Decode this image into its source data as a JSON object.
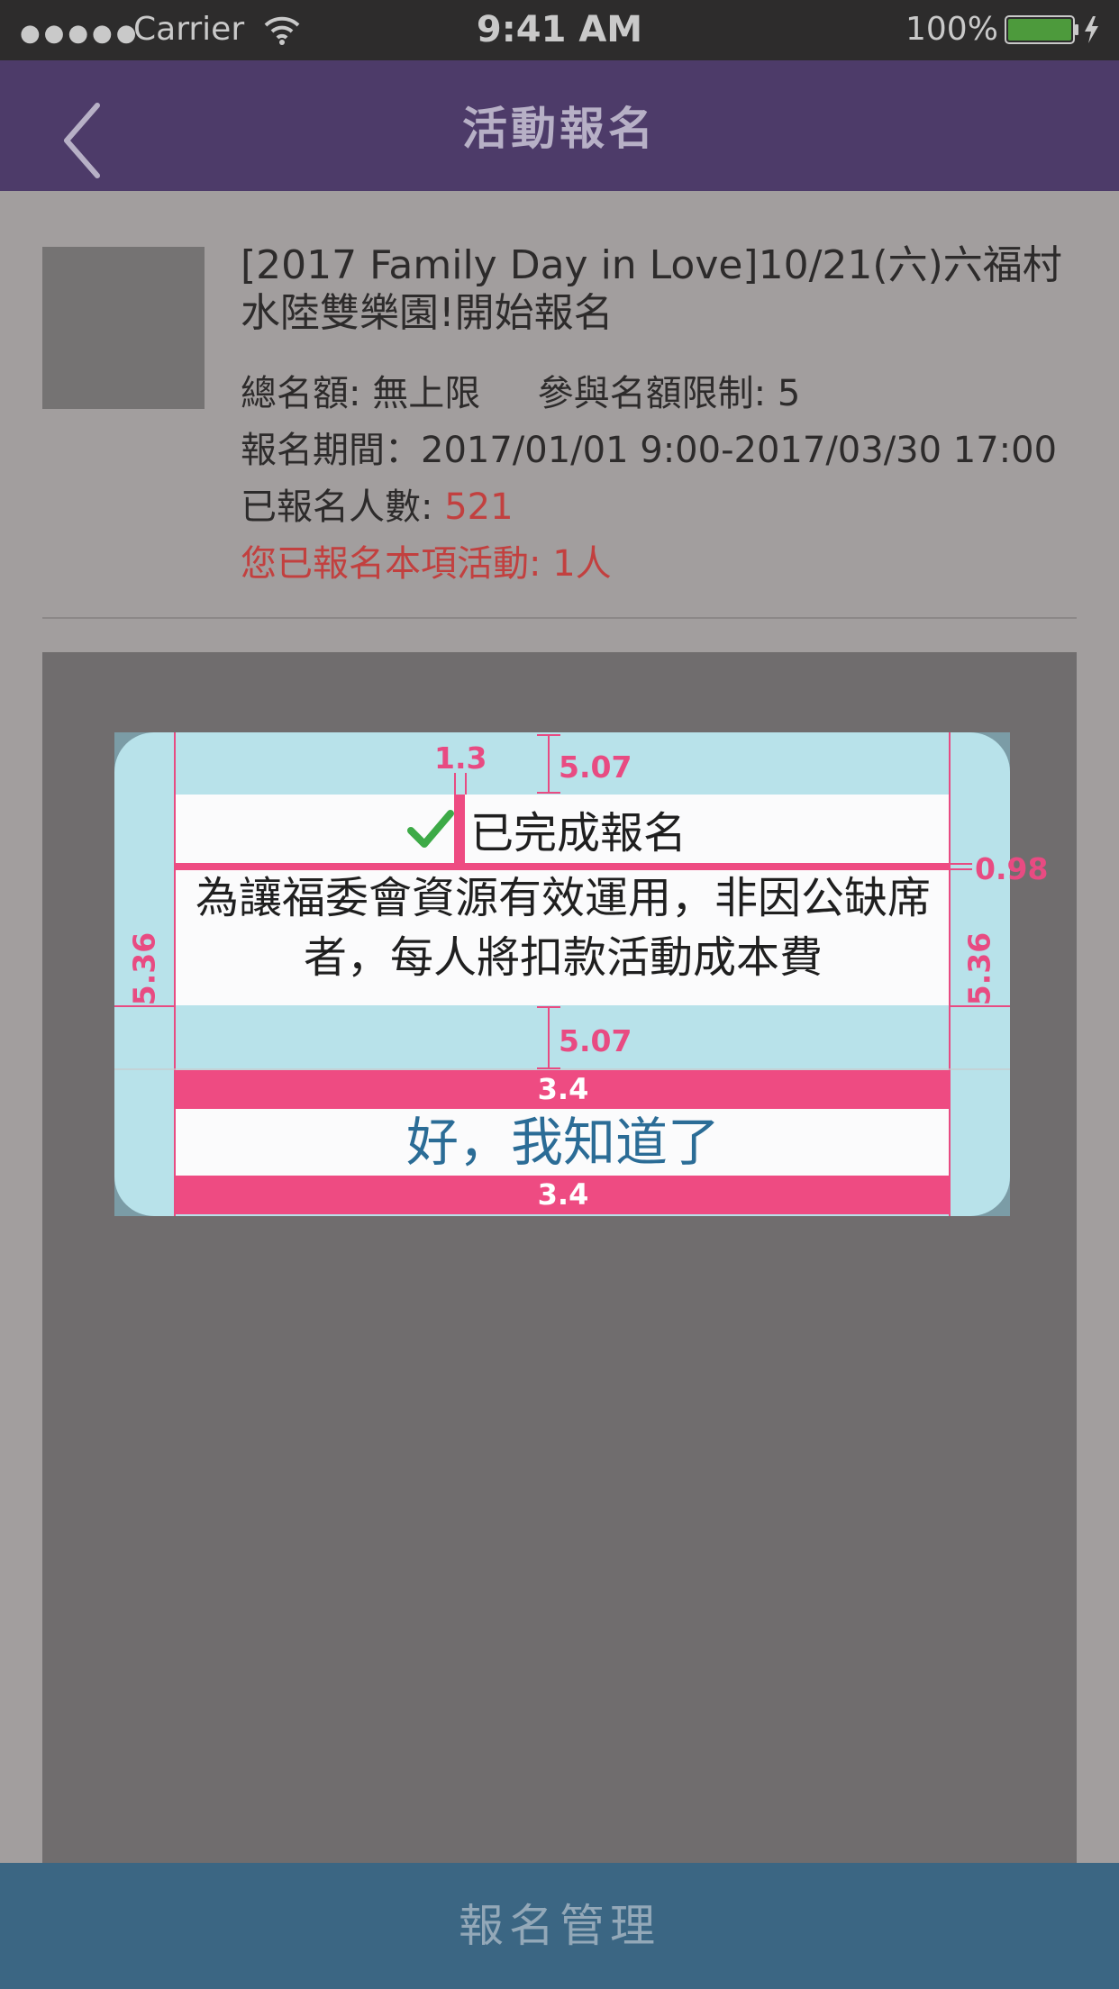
{
  "status_bar": {
    "signal": "●●●●●",
    "carrier": "Carrier",
    "time": "9:41 AM",
    "battery_percent": "100%",
    "battery_level": 1.0
  },
  "nav": {
    "title": "活動報名",
    "back_icon": "chevron-left-icon"
  },
  "event": {
    "title": "[2017 Family Day in Love]10/21(六)六福村水陸雙樂園!開始報名",
    "quota_label": "總名額: 無上限",
    "limit_label": "參與名額限制: 5",
    "period": "報名期間：2017/01/01 9:00-2017/03/30 17:00",
    "registered_label": "已報名人數: ",
    "registered_count": "521",
    "my_registration": "您已報名本項活動: 1人"
  },
  "dialog": {
    "check_icon": "checkmark-icon",
    "title": "已完成報名",
    "message": "為讓福委會資源有效運用，非因公缺席者，每人將扣款活動成本費",
    "ok_label": "好，我知道了"
  },
  "annotations": {
    "icon_gap": "1.3",
    "top_padding": "5.07",
    "title_gap": "0.98",
    "bottom_padding": "5.07",
    "left_margin": "5.36",
    "right_margin": "5.36",
    "button_pad_top": "3.4",
    "button_pad_bottom": "3.4"
  },
  "bottom_bar": {
    "label": "報名管理"
  },
  "colors": {
    "nav_bg": "#4d3b69",
    "bottom_bar_bg": "#3b6683",
    "accent_red": "#c2403f",
    "annotation_pink": "#ee4b82",
    "dialog_fill": "#b8e2ea",
    "ok_text": "#2b6c96",
    "check_green": "#3daa47"
  }
}
